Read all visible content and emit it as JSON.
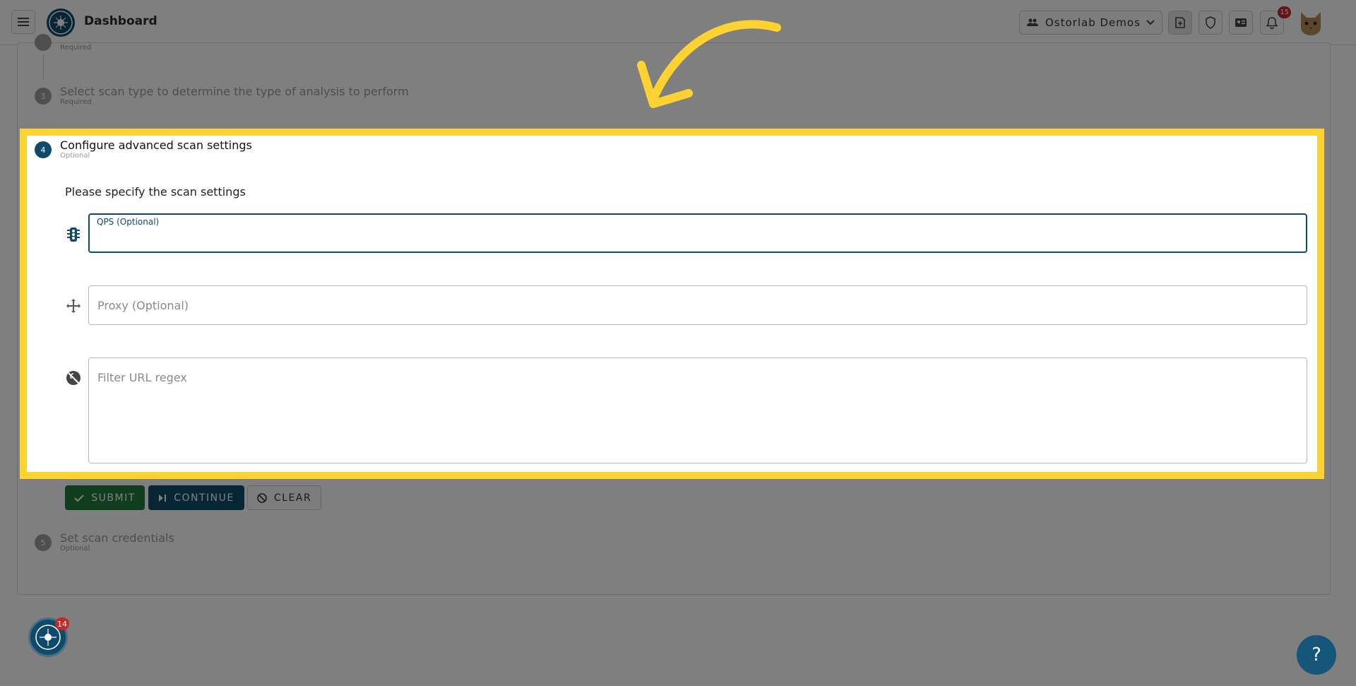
{
  "header": {
    "title": "Dashboard",
    "organization": "Ostorlab Demos",
    "notification_count": "15",
    "icons": [
      "menu-icon",
      "app-logo",
      "people-icon",
      "chevron-down-icon",
      "new-scan-icon",
      "shield-icon",
      "ticket-icon",
      "bell-icon",
      "avatar"
    ]
  },
  "stepper": {
    "step2_sub": "Required",
    "step3": {
      "number": "3",
      "title": "Select scan type to determine the type of analysis to perform",
      "sub": "Required"
    },
    "step4": {
      "number": "4",
      "title": "Configure advanced scan settings",
      "sub": "Optional"
    },
    "step5": {
      "number": "5",
      "title": "Set scan credentials",
      "sub": "Optional"
    }
  },
  "form": {
    "instructions": "Please specify the scan settings",
    "qps_label": "QPS (Optional)",
    "proxy_placeholder": "Proxy (Optional)",
    "filter_placeholder": "Filter URL regex"
  },
  "actions": {
    "submit": "SUBMIT",
    "continue": "CONTINUE",
    "clear": "CLEAR"
  },
  "chat_badge": "14",
  "help_label": "?",
  "colors": {
    "primary": "#0d4a6b",
    "success": "#1f7a3a",
    "highlight": "#fdd231",
    "badge": "#c62828"
  }
}
